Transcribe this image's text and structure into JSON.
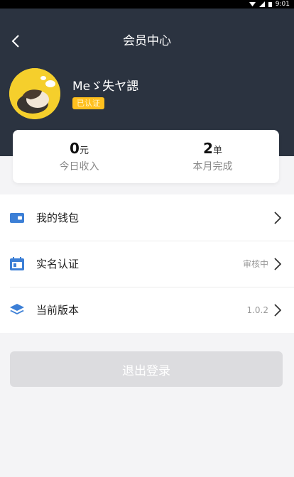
{
  "status_bar": {
    "time": "9:01"
  },
  "header": {
    "title": "会员中心"
  },
  "user": {
    "name": "Meゞ失ヤ諰",
    "badge": "已认证"
  },
  "stats": [
    {
      "value": "0",
      "unit": "元",
      "label": "今日收入"
    },
    {
      "value": "2",
      "unit": "单",
      "label": "本月完成"
    }
  ],
  "menu": [
    {
      "label": "我的钱包",
      "value": "",
      "icon": "wallet-icon"
    },
    {
      "label": "实名认证",
      "value": "审核中",
      "icon": "id-card-icon"
    },
    {
      "label": "当前版本",
      "value": "1.0.2",
      "icon": "layers-icon"
    }
  ],
  "logout_label": "退出登录",
  "colors": {
    "header_bg": "#2b3340",
    "accent_yellow": "#ffc01e",
    "icon_blue": "#3c7fd6",
    "page_bg": "#f4f4f6",
    "logout_bg": "#dcdcdf"
  }
}
